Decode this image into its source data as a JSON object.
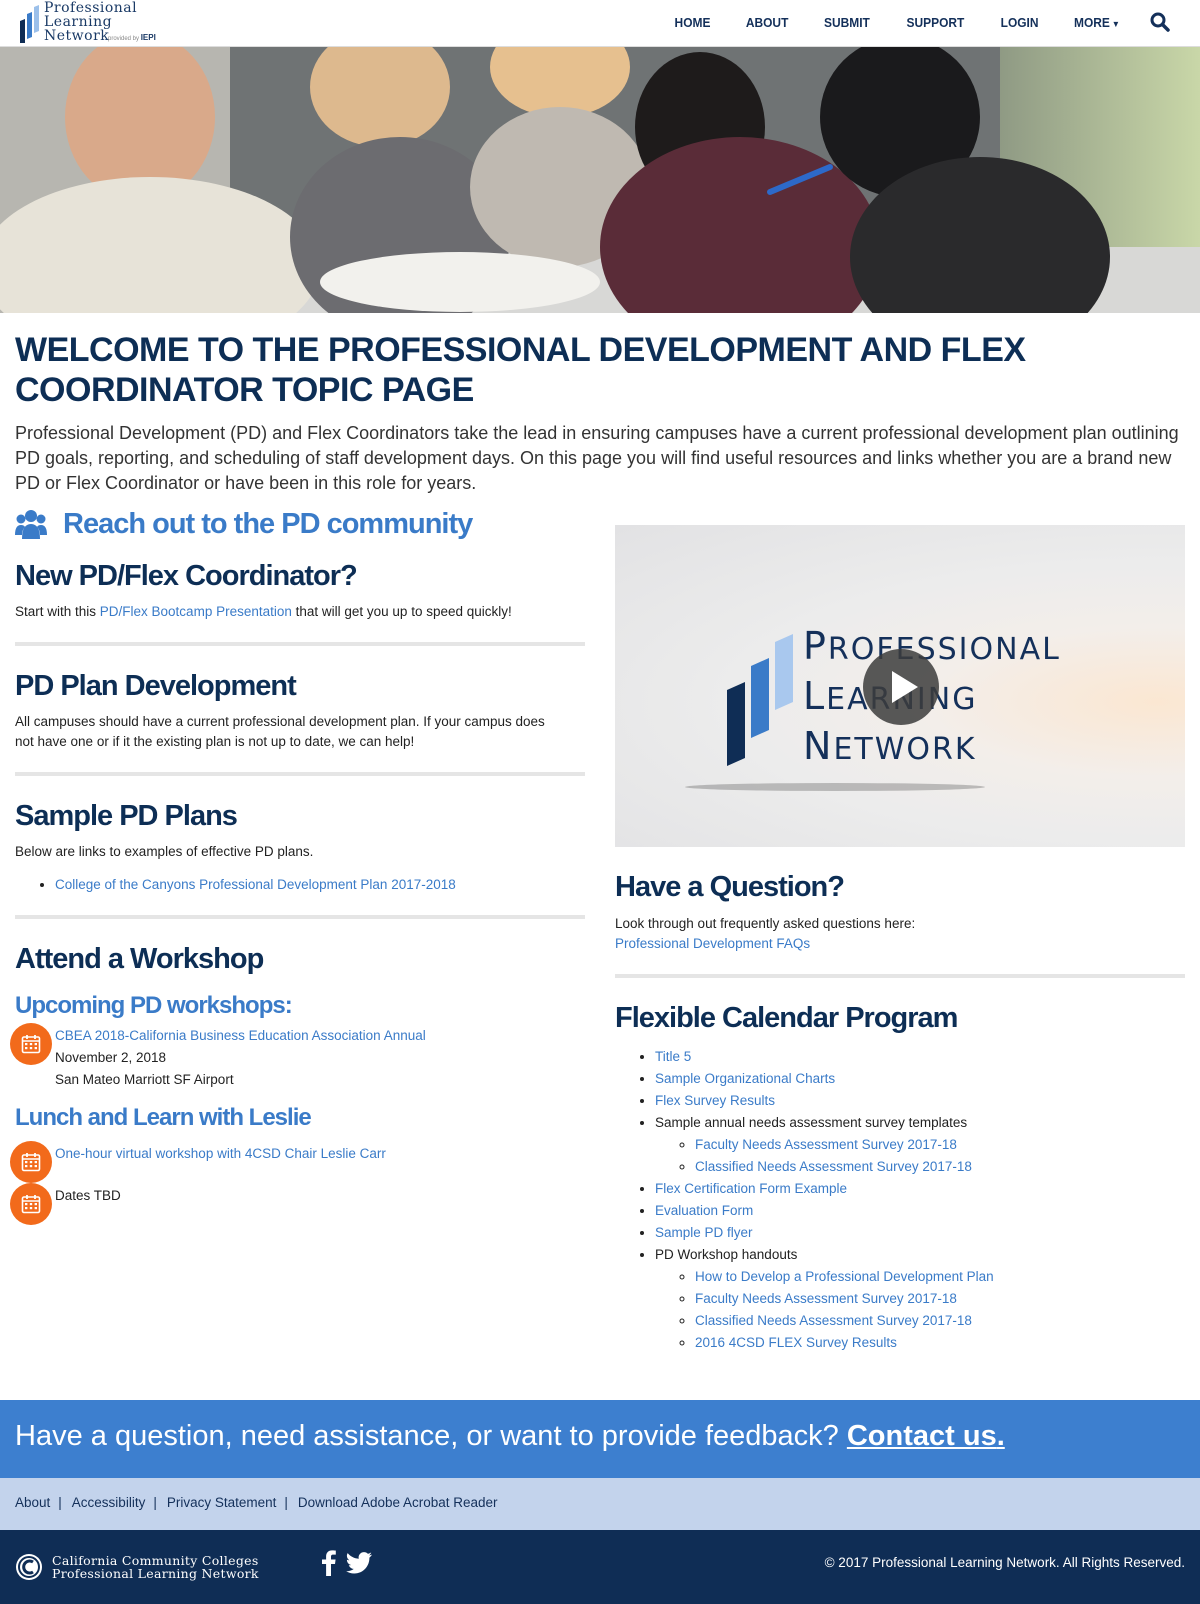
{
  "header": {
    "logo": {
      "line1": "Professional",
      "line2": "Learning",
      "line3": "Network",
      "provided_by": "provided by",
      "iepi": "IEPI"
    },
    "nav": {
      "home": "HOME",
      "about": "ABOUT",
      "submit": "SUBMIT",
      "support": "SUPPORT",
      "login": "LOGIN",
      "more": "MORE"
    }
  },
  "intro": {
    "title": "WELCOME TO THE PROFESSIONAL DEVELOPMENT AND FLEX COORDINATOR TOPIC PAGE",
    "text": "Professional Development (PD) and Flex Coordinators take the lead in ensuring campuses have a current professional development plan outlining PD goals, reporting, and scheduling of staff development days. On this page you will find useful resources and links whether you are a brand new PD or Flex Coordinator or have been in this role for years."
  },
  "left": {
    "reach_title": "Reach out to the PD community",
    "new_coord": {
      "title": "New PD/Flex Coordinator?",
      "pre": "Start with this ",
      "link": "PD/Flex Bootcamp Presentation",
      "post": " that will get you up to speed quickly!"
    },
    "plan_dev": {
      "title": "PD Plan Development",
      "text": "All campuses should have a current professional development plan. If your campus does not have one or if it the existing plan is not up to date, we can help!"
    },
    "sample_plans": {
      "title": "Sample PD Plans",
      "text": "Below are links to examples of effective PD plans.",
      "items": [
        "College of the Canyons Professional Development Plan 2017-2018"
      ]
    },
    "workshop": {
      "title": "Attend a Workshop",
      "upcoming_title": "Upcoming PD workshops:",
      "event1_link": "CBEA 2018-California Business Education Association Annual",
      "event1_date": "November 2, 2018",
      "event1_place": "San Mateo Marriott SF Airport",
      "lunch_title": "Lunch and Learn with Leslie",
      "event2_link": "One-hour virtual workshop with 4CSD Chair Leslie Carr",
      "event3_text": "Dates TBD"
    }
  },
  "right": {
    "video": {
      "line1_cap": "P",
      "line1_rest": "ROFESSIONAL",
      "line2_cap": "L",
      "line2_rest": "EARNING",
      "line3_cap": "N",
      "line3_rest": "ETWORK"
    },
    "question": {
      "title": "Have a Question?",
      "text": "Look through out frequently asked questions here:",
      "link": "Professional Development FAQs"
    },
    "fcp": {
      "title": "Flexible Calendar Program",
      "title5": "Title 5",
      "org_charts": "Sample Organizational Charts",
      "survey_results": "Flex Survey Results",
      "needs_templates": "Sample annual needs assessment survey templates",
      "faculty_needs": "Faculty Needs Assessment Survey 2017-18",
      "classified_needs": "Classified Needs Assessment Survey 2017-18",
      "cert_form": "Flex Certification Form Example",
      "eval_form": "Evaluation Form",
      "pd_flyer": "Sample PD flyer",
      "handouts": "PD Workshop handouts",
      "how_to": "How to Develop a Professional Development Plan",
      "faculty_needs2": "Faculty Needs Assessment Survey 2017-18",
      "classified_needs2": "Classified Needs Assessment Survey 2017-18",
      "flex_2016": "2016 4CSD FLEX Survey Results"
    }
  },
  "contact": {
    "text": "Have a question, need assistance, or want to provide feedback? ",
    "link": "Contact us",
    "period": "."
  },
  "footer_links": {
    "about": "About",
    "accessibility": "Accessibility",
    "privacy": "Privacy Statement",
    "acrobat": "Download Adobe Acrobat Reader",
    "sep": "|"
  },
  "footer": {
    "line1": "California Community Colleges",
    "line2": "Professional Learning Network",
    "copyright": "© 2017 Professional Learning Network. All Rights Reserved."
  },
  "colors": {
    "navy": "#0d2e55",
    "link_blue": "#3a7bc8",
    "orange": "#f26a1b",
    "contact_band": "#3d7fcf",
    "links_band": "#c3d3ec",
    "footer": "#0f2d55"
  }
}
